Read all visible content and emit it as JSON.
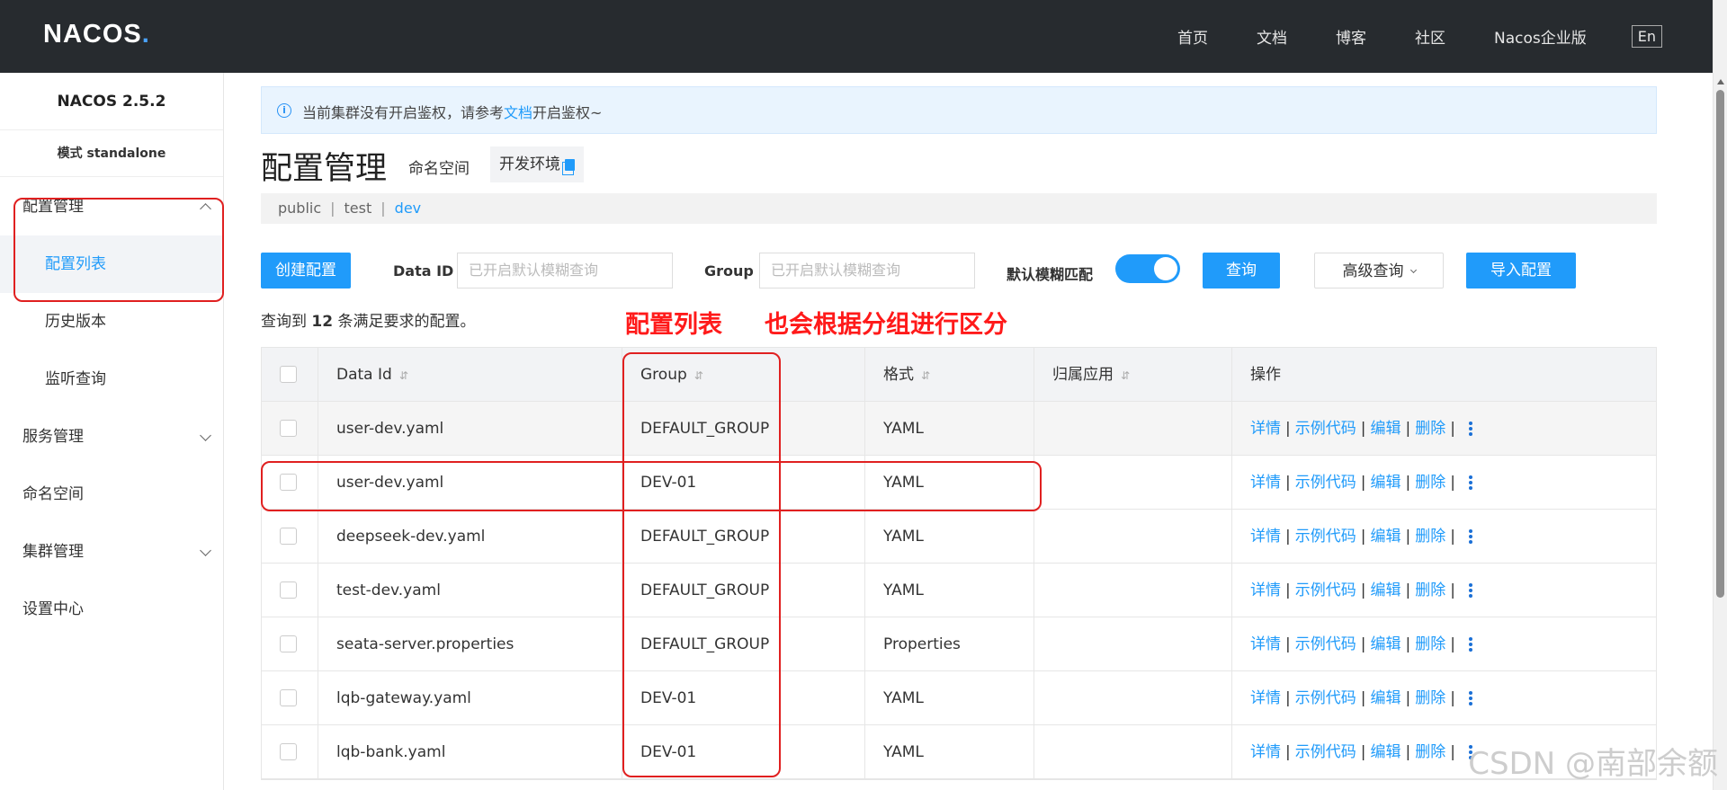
{
  "topbar": {
    "logo": "NACOS",
    "logo_dot": ".",
    "nav": [
      "首页",
      "文档",
      "博客",
      "社区",
      "Nacos企业版"
    ],
    "lang": "En"
  },
  "sidebar": {
    "version": "NACOS 2.5.2",
    "mode": "模式 standalone",
    "items": [
      {
        "label": "配置管理"
      },
      {
        "label": "配置列表"
      },
      {
        "label": "历史版本"
      },
      {
        "label": "监听查询"
      },
      {
        "label": "服务管理"
      },
      {
        "label": "命名空间"
      },
      {
        "label": "集群管理"
      },
      {
        "label": "设置中心"
      }
    ]
  },
  "notice": {
    "prefix": "当前集群没有开启鉴权，请参考",
    "link": "文档",
    "suffix": "开启鉴权~"
  },
  "page": {
    "title": "配置管理",
    "ns_label": "命名空间",
    "ns_value": "开发环境",
    "namespaces": [
      "public",
      "test",
      "dev"
    ],
    "sep": "|"
  },
  "toolbar": {
    "create": "创建配置",
    "dataid_label": "Data ID",
    "dataid_placeholder": "已开启默认模糊查询",
    "group_label": "Group",
    "group_placeholder": "已开启默认模糊查询",
    "fuzzy_label": "默认模糊匹配",
    "fuzzy_on": true,
    "query": "查询",
    "advanced": "高级查询",
    "import": "导入配置"
  },
  "result": {
    "prefix": "查询到",
    "count": "12",
    "suffix": "条满足要求的配置。"
  },
  "table": {
    "headers": [
      "Data Id",
      "Group",
      "格式",
      "归属应用",
      "操作"
    ],
    "sort_icon": "⇵",
    "ops": [
      "详情",
      "示例代码",
      "编辑",
      "删除"
    ],
    "rows": [
      {
        "data_id": "user-dev.yaml",
        "group": "DEFAULT_GROUP",
        "format": "YAML",
        "app": ""
      },
      {
        "data_id": "user-dev.yaml",
        "group": "DEV-01",
        "format": "YAML",
        "app": ""
      },
      {
        "data_id": "deepseek-dev.yaml",
        "group": "DEFAULT_GROUP",
        "format": "YAML",
        "app": ""
      },
      {
        "data_id": "test-dev.yaml",
        "group": "DEFAULT_GROUP",
        "format": "YAML",
        "app": ""
      },
      {
        "data_id": "seata-server.properties",
        "group": "DEFAULT_GROUP",
        "format": "Properties",
        "app": ""
      },
      {
        "data_id": "lqb-gateway.yaml",
        "group": "DEV-01",
        "format": "YAML",
        "app": ""
      },
      {
        "data_id": "lqb-bank.yaml",
        "group": "DEV-01",
        "format": "YAML",
        "app": ""
      }
    ]
  },
  "annotation": {
    "text1": "配置列表",
    "text2": "也会根据分组进行区分"
  },
  "watermark": "CSDN @南部余额",
  "colors": {
    "accent": "#209bfa",
    "topbar": "#272b2f",
    "annotation": "#e02020"
  }
}
